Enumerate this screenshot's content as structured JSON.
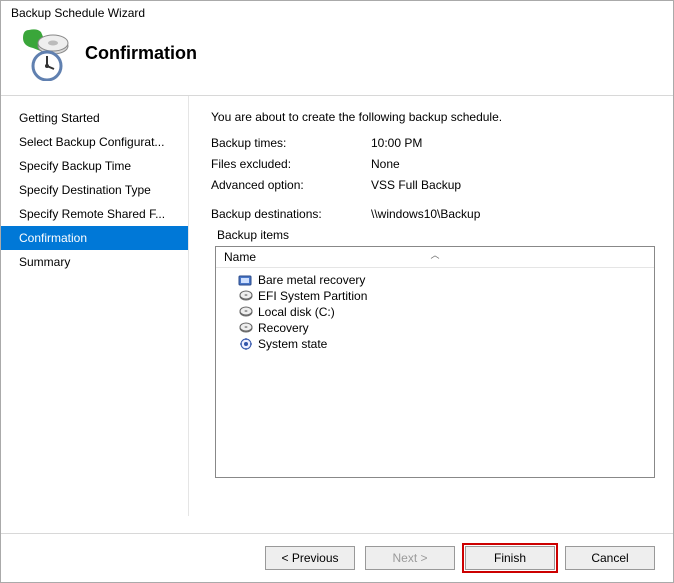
{
  "window": {
    "title": "Backup Schedule Wizard"
  },
  "header": {
    "heading": "Confirmation"
  },
  "sidebar": {
    "items": [
      {
        "label": "Getting Started"
      },
      {
        "label": "Select Backup Configurat..."
      },
      {
        "label": "Specify Backup Time"
      },
      {
        "label": "Specify Destination Type"
      },
      {
        "label": "Specify Remote Shared F..."
      },
      {
        "label": "Confirmation"
      },
      {
        "label": "Summary"
      }
    ],
    "selected_index": 5
  },
  "main": {
    "intro": "You are about to create the following backup schedule.",
    "rows": [
      {
        "label": "Backup times:",
        "value": "10:00 PM"
      },
      {
        "label": "Files excluded:",
        "value": "None"
      },
      {
        "label": "Advanced option:",
        "value": "VSS Full Backup"
      }
    ],
    "dest_row": {
      "label": "Backup destinations:",
      "value": "\\\\windows10\\Backup"
    },
    "items_label": "Backup items",
    "list": {
      "header": "Name",
      "rows": [
        {
          "icon": "bare-metal",
          "label": "Bare metal recovery"
        },
        {
          "icon": "disk",
          "label": "EFI System Partition"
        },
        {
          "icon": "disk",
          "label": "Local disk (C:)"
        },
        {
          "icon": "disk",
          "label": "Recovery"
        },
        {
          "icon": "gear",
          "label": "System state"
        }
      ]
    }
  },
  "footer": {
    "previous": "< Previous",
    "next": "Next >",
    "finish": "Finish",
    "cancel": "Cancel"
  }
}
